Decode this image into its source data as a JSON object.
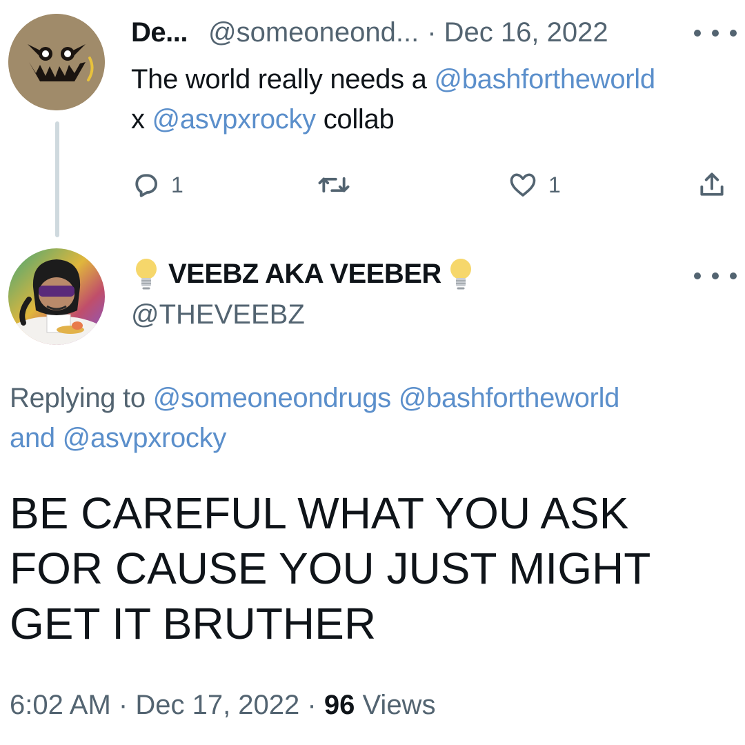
{
  "tweet1": {
    "author_name": "De...",
    "author_handle": "@someoneond...",
    "date": "· Dec 16, 2022",
    "text_before": "The world really needs a ",
    "mention1": "@bashfortheworld",
    "text_middle": "x ",
    "mention2": "@asvpxrocky",
    "text_after": " collab",
    "reply_count": "1",
    "like_count": "1"
  },
  "tweet2": {
    "author_name": "VEEBZ AKA VEEBER",
    "author_handle": "@THEVEEBZ",
    "replying_prefix": "Replying to ",
    "replying_mention1": "@someoneondrugs",
    "replying_mention2": "@bashfortheworld",
    "replying_and": "and ",
    "replying_mention3": "@asvpxrocky",
    "text": "BE CAREFUL WHAT YOU ASK FOR CAUSE YOU JUST MIGHT GET IT BRUTHER",
    "time": "6:02 AM",
    "date": "Dec 17, 2022",
    "views_count": "96",
    "views_label": "Views"
  },
  "icons": [
    "more-icon",
    "reply-icon",
    "retweet-icon",
    "like-icon",
    "share-icon",
    "lightbulb-icon"
  ],
  "colors": {
    "link": "#5b8fcb",
    "text": "#0f1419",
    "secondary": "#536471",
    "thread_line": "#cfd9de"
  }
}
